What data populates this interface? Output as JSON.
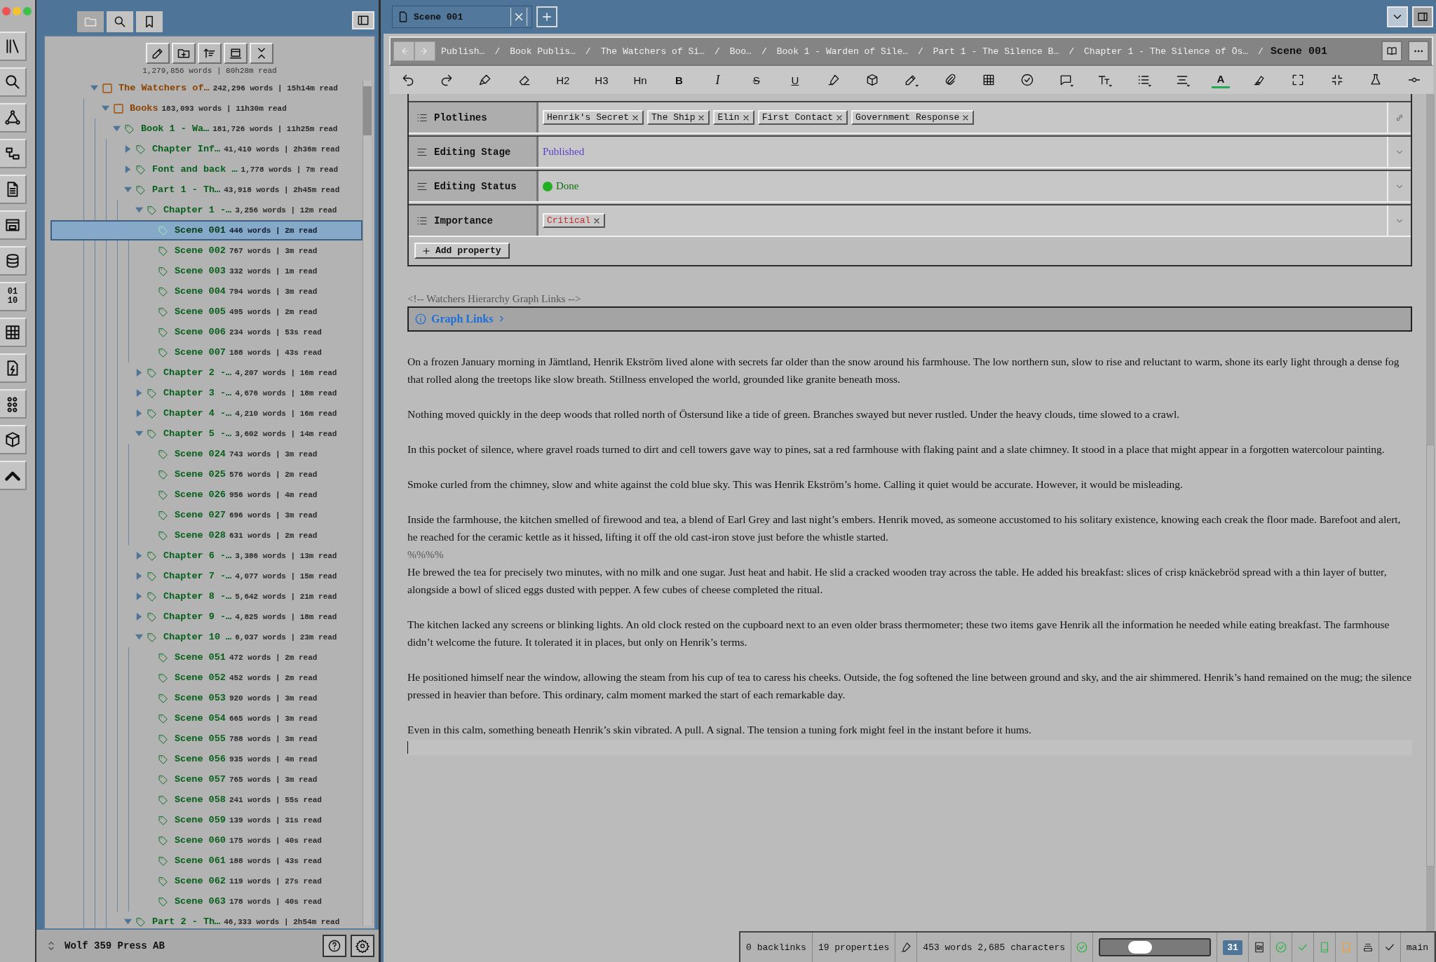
{
  "rail": {
    "binary_label": [
      "01",
      "10"
    ]
  },
  "sidebar": {
    "tabs": [
      {
        "selected": true
      },
      {
        "selected": false
      },
      {
        "selected": false
      }
    ],
    "stats": "1,279,856 words | 80h28m read",
    "tree": [
      {
        "label": "The Watchers of…",
        "meta": "242,296 words | 15h14m read",
        "kind": "folder",
        "expanded": true,
        "selected": false,
        "children": [
          {
            "label": "Books",
            "meta": "183,093 words | 11h30m read",
            "kind": "folder",
            "expanded": true,
            "selected": false,
            "children": [
              {
                "label": "Book 1 - Wa…",
                "meta": "181,726 words | 11h25m read",
                "kind": "item",
                "expanded": true,
                "selected": false,
                "children": [
                  {
                    "label": "Chapter Inf…",
                    "meta": "41,410 words | 2h36m read",
                    "kind": "item",
                    "expanded": false,
                    "selected": false
                  },
                  {
                    "label": "Font and back …",
                    "meta": "1,778 words | 7m read",
                    "kind": "item",
                    "expanded": false,
                    "selected": false
                  },
                  {
                    "label": "Part 1 - Th…",
                    "meta": "43,918 words | 2h45m read",
                    "kind": "item",
                    "expanded": true,
                    "selected": false,
                    "children": [
                      {
                        "label": "Chapter 1 -…",
                        "meta": "3,256 words | 12m read",
                        "kind": "item",
                        "expanded": true,
                        "selected": false,
                        "children": [
                          {
                            "label": "Scene 001",
                            "meta": "446 words | 2m read",
                            "kind": "item",
                            "selected": true
                          },
                          {
                            "label": "Scene 002",
                            "meta": "767 words | 3m read",
                            "kind": "item",
                            "selected": false
                          },
                          {
                            "label": "Scene 003",
                            "meta": "332 words | 1m read",
                            "kind": "item",
                            "selected": false
                          },
                          {
                            "label": "Scene 004",
                            "meta": "794 words | 3m read",
                            "kind": "item",
                            "selected": false
                          },
                          {
                            "label": "Scene 005",
                            "meta": "495 words | 2m read",
                            "kind": "item",
                            "selected": false
                          },
                          {
                            "label": "Scene 006",
                            "meta": "234 words | 53s read",
                            "kind": "item",
                            "selected": false
                          },
                          {
                            "label": "Scene 007",
                            "meta": "188 words | 43s read",
                            "kind": "item",
                            "selected": false
                          }
                        ]
                      },
                      {
                        "label": "Chapter 2 -…",
                        "meta": "4,207 words | 16m read",
                        "kind": "item",
                        "expanded": false,
                        "selected": false
                      },
                      {
                        "label": "Chapter 3 -…",
                        "meta": "4,676 words | 18m read",
                        "kind": "item",
                        "expanded": false,
                        "selected": false
                      },
                      {
                        "label": "Chapter 4 -…",
                        "meta": "4,210 words | 16m read",
                        "kind": "item",
                        "expanded": false,
                        "selected": false
                      },
                      {
                        "label": "Chapter 5 -…",
                        "meta": "3,602 words | 14m read",
                        "kind": "item",
                        "expanded": true,
                        "selected": false,
                        "children": [
                          {
                            "label": "Scene 024",
                            "meta": "743 words | 3m read",
                            "kind": "item",
                            "selected": false
                          },
                          {
                            "label": "Scene 025",
                            "meta": "576 words | 2m read",
                            "kind": "item",
                            "selected": false
                          },
                          {
                            "label": "Scene 026",
                            "meta": "956 words | 4m read",
                            "kind": "item",
                            "selected": false
                          },
                          {
                            "label": "Scene 027",
                            "meta": "696 words | 3m read",
                            "kind": "item",
                            "selected": false
                          },
                          {
                            "label": "Scene 028",
                            "meta": "631 words | 2m read",
                            "kind": "item",
                            "selected": false
                          }
                        ]
                      },
                      {
                        "label": "Chapter 6 -…",
                        "meta": "3,386 words | 13m read",
                        "kind": "item",
                        "expanded": false,
                        "selected": false
                      },
                      {
                        "label": "Chapter 7 -…",
                        "meta": "4,077 words | 15m read",
                        "kind": "item",
                        "expanded": false,
                        "selected": false
                      },
                      {
                        "label": "Chapter 8 -…",
                        "meta": "5,642 words | 21m read",
                        "kind": "item",
                        "expanded": false,
                        "selected": false
                      },
                      {
                        "label": "Chapter 9 -…",
                        "meta": "4,825 words | 18m read",
                        "kind": "item",
                        "expanded": false,
                        "selected": false
                      },
                      {
                        "label": "Chapter 10 …",
                        "meta": "6,037 words | 23m read",
                        "kind": "item",
                        "expanded": true,
                        "selected": false,
                        "children": [
                          {
                            "label": "Scene 051",
                            "meta": "472 words | 2m read",
                            "kind": "item",
                            "selected": false
                          },
                          {
                            "label": "Scene 052",
                            "meta": "452 words | 2m read",
                            "kind": "item",
                            "selected": false
                          },
                          {
                            "label": "Scene 053",
                            "meta": "920 words | 3m read",
                            "kind": "item",
                            "selected": false
                          },
                          {
                            "label": "Scene 054",
                            "meta": "665 words | 3m read",
                            "kind": "item",
                            "selected": false
                          },
                          {
                            "label": "Scene 055",
                            "meta": "788 words | 3m read",
                            "kind": "item",
                            "selected": false
                          },
                          {
                            "label": "Scene 056",
                            "meta": "935 words | 4m read",
                            "kind": "item",
                            "selected": false
                          },
                          {
                            "label": "Scene 057",
                            "meta": "765 words | 3m read",
                            "kind": "item",
                            "selected": false
                          },
                          {
                            "label": "Scene 058",
                            "meta": "241 words | 55s read",
                            "kind": "item",
                            "selected": false
                          },
                          {
                            "label": "Scene 059",
                            "meta": "139 words | 31s read",
                            "kind": "item",
                            "selected": false
                          },
                          {
                            "label": "Scene 060",
                            "meta": "175 words | 40s read",
                            "kind": "item",
                            "selected": false
                          },
                          {
                            "label": "Scene 061",
                            "meta": "188 words | 43s read",
                            "kind": "item",
                            "selected": false
                          },
                          {
                            "label": "Scene 062",
                            "meta": "119 words | 27s read",
                            "kind": "item",
                            "selected": false
                          },
                          {
                            "label": "Scene 063",
                            "meta": "178 words | 40s read",
                            "kind": "item",
                            "selected": false
                          }
                        ]
                      }
                    ]
                  },
                  {
                    "label": "Part 2 - Th…",
                    "meta": "46,333 words | 2h54m read",
                    "kind": "item",
                    "expanded": true,
                    "selected": false
                  }
                ]
              }
            ]
          }
        ]
      }
    ],
    "footer": {
      "workspace": "Wolf 359 Press AB"
    }
  },
  "editor": {
    "tab": {
      "title": "Scene 001"
    },
    "breadcrumb": {
      "separator": "/",
      "items": [
        "Publish…",
        "Book Publis…",
        "The Watchers of Si…",
        "Boo…",
        "Book 1 - Warden of Sile…",
        "Part 1 - The Silence B…",
        "Chapter 1 - The Silence of Ös…"
      ],
      "current": "Scene 001"
    },
    "toolbar": {
      "headings": [
        "H2",
        "H3",
        "Hn"
      ],
      "formats": [
        "B",
        "I",
        "S",
        "U"
      ],
      "text_color": "A"
    },
    "properties": [
      {
        "name": "Plotlines",
        "kind": "tags",
        "values": [
          "Henrik's Secret",
          "The Ship",
          "Elin",
          "First Contact",
          "Government Response"
        ]
      },
      {
        "name": "Editing Stage",
        "kind": "text",
        "value": "Published"
      },
      {
        "name": "Editing Status",
        "kind": "status",
        "value": "Done"
      },
      {
        "name": "Importance",
        "kind": "priority",
        "values": [
          "Critical"
        ]
      }
    ],
    "add_property": "Add property",
    "comment": "<!-- Watchers Hierarchy Graph Links -->",
    "callout": {
      "title": "Graph Links"
    },
    "body": [
      {
        "kind": "paragraph",
        "text": "On a frozen January morning in Jämtland, Henrik Ekström lived alone with secrets far older than the snow around his farmhouse. The low northern sun, slow to rise and reluctant to warm, shone its early light through a dense fog that rolled along the treetops like slow breath. Stillness enveloped the world, grounded like granite beneath moss."
      },
      {
        "kind": "paragraph",
        "text": "Nothing moved quickly in the deep woods that rolled north of Östersund like a tide of green. Branches swayed but never rustled. Under the heavy clouds, time slowed to a crawl."
      },
      {
        "kind": "paragraph",
        "text": "In this pocket of silence, where gravel roads turned to dirt and cell towers gave way to pines, sat a red farmhouse with flaking paint and a slate chimney. It stood in a place that might appear in a forgotten watercolour painting."
      },
      {
        "kind": "paragraph",
        "text": "Smoke curled from the chimney, slow and white against the cold blue sky. This was Henrik Ekström’s home. Calling it quiet would be accurate. However, it would be misleading."
      },
      {
        "kind": "paragraph",
        "text": "Inside the farmhouse, the kitchen smelled of firewood and tea, a blend of Earl Grey and last night’s embers. Henrik moved, as someone accustomed to his solitary existence, knowing each creak the floor made. Barefoot and alert, he reached for the ceramic kettle as it hissed, lifting it off the old cast-iron stove just before the whistle started."
      },
      {
        "kind": "marker",
        "text": "%%%%"
      },
      {
        "kind": "paragraph",
        "text": "He brewed the tea for precisely two minutes, with no milk and one sugar. Just heat and habit. He slid a cracked wooden tray across the table. He added his breakfast: slices of crisp knäckebröd spread with a thin layer of butter, alongside a bowl of sliced eggs dusted with pepper. A few cubes of cheese completed the ritual."
      },
      {
        "kind": "paragraph",
        "text": "The kitchen lacked any screens or blinking lights. An old clock rested on the cupboard next to an even older brass thermometer; these two items gave Henrik all the information he needed while eating breakfast. The farmhouse didn’t welcome the future. It tolerated it in places, but only on Henrik’s terms."
      },
      {
        "kind": "paragraph",
        "text": "He positioned himself near the window, allowing the steam from his cup of tea to caress his cheeks. Outside, the fog softened the line between ground and sky, and the air shimmered. Henrik’s hand remained on the mug; the silence pressed in heavier than before. This ordinary, calm moment marked the start of each remarkable day."
      },
      {
        "kind": "paragraph",
        "text": "Even in this calm, something beneath Henrik’s skin vibrated. A pull. A signal. The tension a tuning fork might feel in the instant before it hums."
      }
    ]
  },
  "status_bar": {
    "backlinks": "0 backlinks",
    "properties": "19 properties",
    "counts": "453 words 2,685 characters",
    "toggle": {
      "on": false
    },
    "badge": "31",
    "branch": "main"
  }
}
